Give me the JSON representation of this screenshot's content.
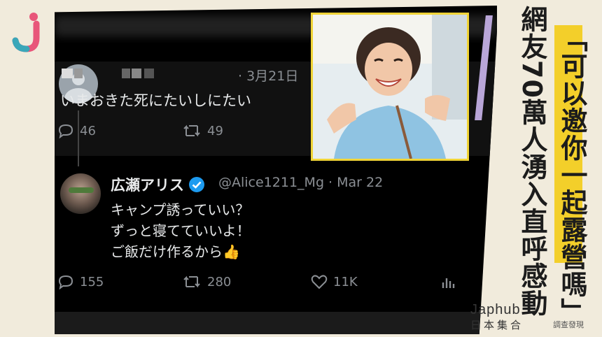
{
  "tweet1": {
    "date": "· 3月21日",
    "text": "いまおきた死にたいしにたい",
    "replies": "46",
    "retweets": "49"
  },
  "tweet2": {
    "name": "広瀬アリス",
    "handle": "@Alice1211_Mg · Mar 22",
    "lines": [
      "キャンプ誘っていい？",
      "ずっと寝てていいよ！",
      "ご飯だけ作るから👍"
    ],
    "replies": "155",
    "retweets": "280",
    "likes": "11K"
  },
  "headline": {
    "main": "網友70萬人湧入直呼感動",
    "quote": "「可以邀你一起露營嗎」"
  },
  "brand": {
    "en": "Japhub",
    "jp": "日本集合",
    "sub": "調查發現"
  },
  "colors": {
    "accent_yellow": "#f3cf2a",
    "accent_purple": "#b9a6d8",
    "verified_blue": "#1d9bf0",
    "logo_pink": "#e8567a",
    "logo_teal": "#3aa7b9"
  }
}
